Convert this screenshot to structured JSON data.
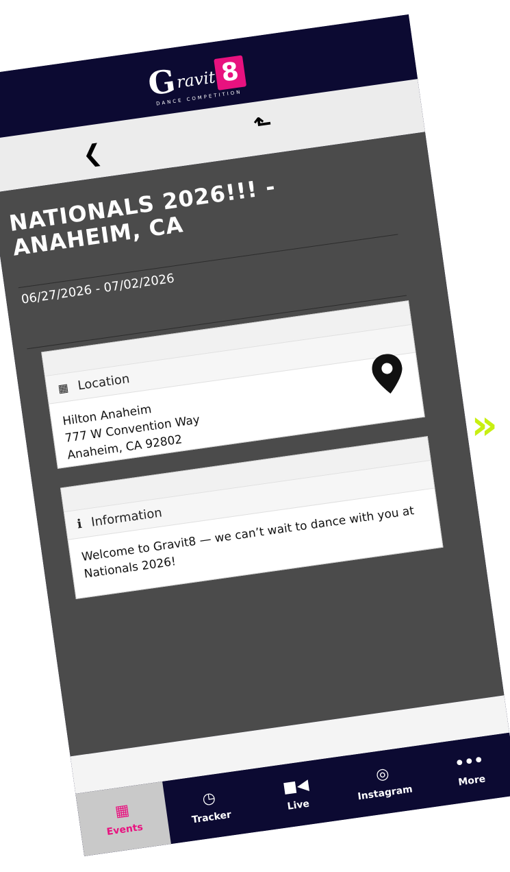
{
  "colors": {
    "brand_navy": "#0c0a32",
    "brand_pink": "#e8127f",
    "content_bg": "#4b4b4b",
    "accent_lime": "#c8ef12"
  },
  "header": {
    "logo_initial": "G",
    "logo_word": "ravit",
    "logo_number": "8",
    "logo_tagline": "DANCE COMPETITION"
  },
  "navbar": {
    "back_icon": "chevron-left-icon",
    "share_icon": "share-icon"
  },
  "event": {
    "title": "NATIONALS 2026!!! - ANAHEIM, CA",
    "dates": "06/27/2026 - 07/02/2026"
  },
  "location": {
    "heading": "Location",
    "icon": "map-icon",
    "line1": "Hilton Anaheim",
    "line2": "777 W Convention Way",
    "line3": "Anaheim, CA 92802",
    "pin_icon": "location-pin-icon"
  },
  "information": {
    "heading": "Information",
    "icon": "info-icon",
    "text": "Welcome to Gravit8 — we can’t wait to dance with you at Nationals 2026!"
  },
  "tabs": [
    {
      "label": "Events",
      "icon": "calendar-icon",
      "active": true
    },
    {
      "label": "Tracker",
      "icon": "clock-icon",
      "active": false
    },
    {
      "label": "Live",
      "icon": "video-camera-icon",
      "active": false
    },
    {
      "label": "Instagram",
      "icon": "instagram-icon",
      "active": false
    },
    {
      "label": "More",
      "icon": "more-dots-icon",
      "active": false
    }
  ],
  "decoration": {
    "arrow_icon": "double-chevron-right-icon"
  }
}
